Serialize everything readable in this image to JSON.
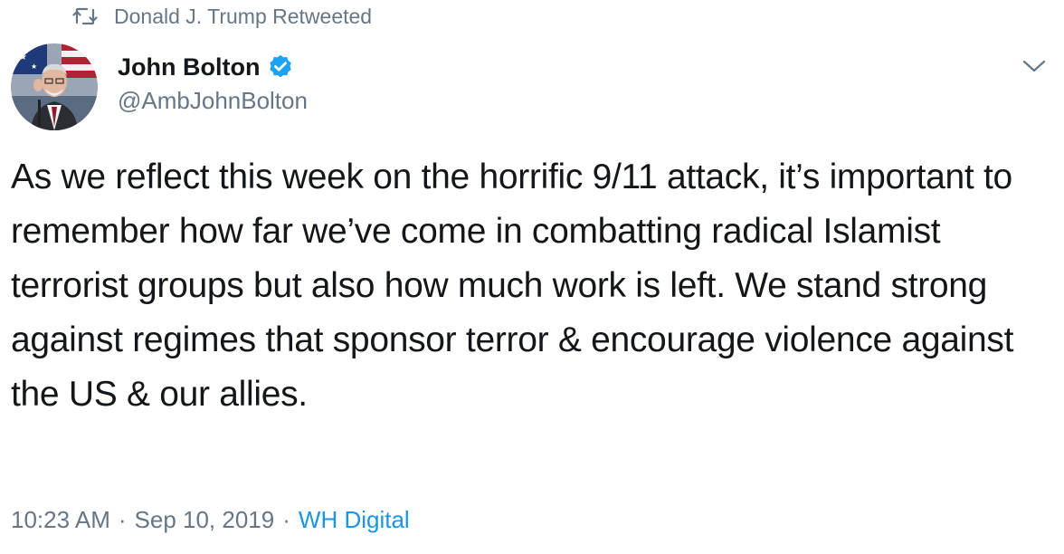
{
  "retweet": {
    "text": "Donald J. Trump Retweeted",
    "icon": "retweet-icon"
  },
  "author": {
    "display_name": "John Bolton",
    "handle": "@AmbJohnBolton",
    "verified": true,
    "verified_icon": "verified-badge-icon"
  },
  "tweet": {
    "text": "As we reflect this week on the horrific 9/11 attack, it’s important to remember how far we’ve come in combatting radical Islamist terrorist groups but also how much work is left. We stand strong against regimes that sponsor terror & encourage violence against the US & our allies."
  },
  "meta": {
    "time": "10:23 AM",
    "separator": "·",
    "date": "Sep 10, 2019",
    "source": "WH Digital"
  },
  "colors": {
    "text_primary": "#14171a",
    "text_secondary": "#657786",
    "link": "#1b95e0",
    "verified": "#1da1f2"
  },
  "icons": {
    "menu": "chevron-down-icon"
  }
}
